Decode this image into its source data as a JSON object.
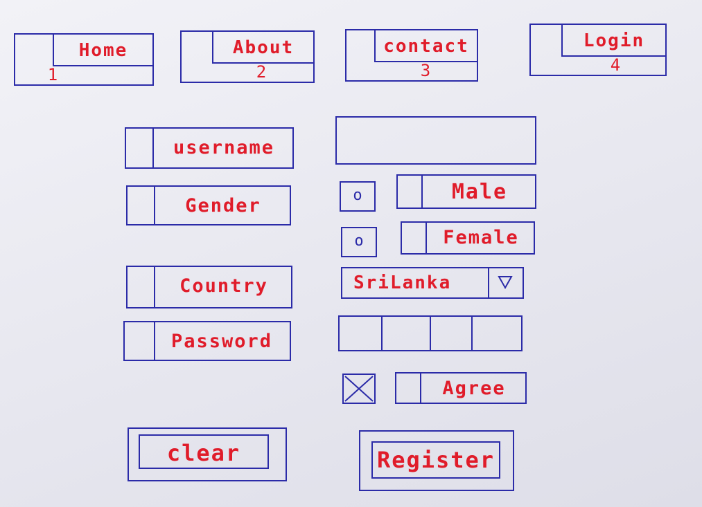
{
  "nav": [
    {
      "label": "Home",
      "number": "1"
    },
    {
      "label": "About",
      "number": "2"
    },
    {
      "label": "contact",
      "number": "3"
    },
    {
      "label": "Login",
      "number": "4"
    }
  ],
  "form": {
    "username_label": "username",
    "username_value": "",
    "gender_label": "Gender",
    "gender_options": [
      "Male",
      "Female"
    ],
    "radio_mark": "o",
    "country_label": "Country",
    "country_selected": "SriLanka",
    "password_label": "Password",
    "agree_label": "Agree",
    "agree_checked": true
  },
  "buttons": {
    "clear": "clear",
    "register": "Register"
  },
  "colors": {
    "ink": "#2b2ba8",
    "text": "#e01c2a",
    "paper": "#ececf2"
  }
}
